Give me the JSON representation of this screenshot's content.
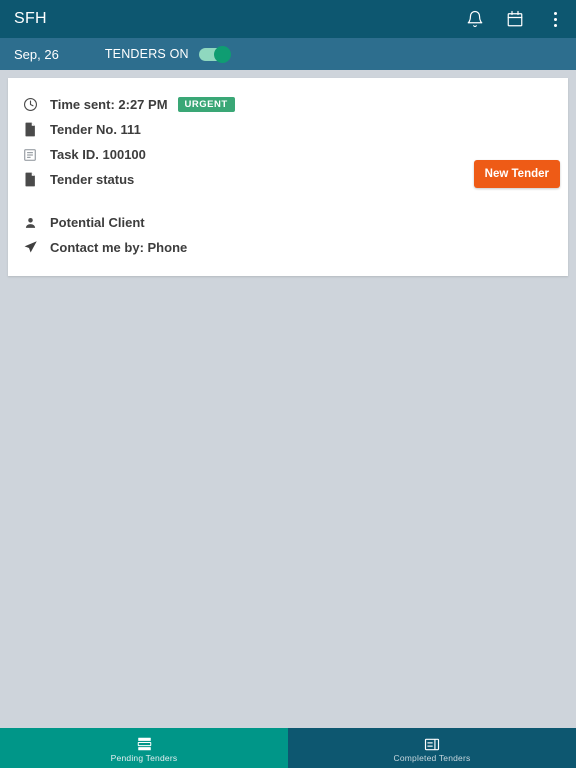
{
  "appbar": {
    "title": "SFH",
    "actions": [
      {
        "name": "notifications-icon",
        "label": "Notifications"
      },
      {
        "name": "calendar-icon",
        "label": "Calendar"
      },
      {
        "name": "overflow-menu-icon",
        "label": "More options"
      }
    ],
    "background_color": "#0d5770"
  },
  "subbar": {
    "date": "Sep, 26",
    "toggle_label": "TENDERS ON",
    "toggle_state": "on",
    "background_color": "#2d6e8e",
    "toggle_track_color": "#8fd8bf",
    "toggle_knob_color": "#0f9d72"
  },
  "card": {
    "rows": [
      {
        "icon": "clock-icon",
        "text": "Time sent: 2:27 PM",
        "badge": "URGENT"
      },
      {
        "icon": "document-icon",
        "text": "Tender No. 111",
        "badge": null
      },
      {
        "icon": "description-icon",
        "text": "Task ID. 100100",
        "badge": null
      },
      {
        "icon": "document-icon",
        "text": "Tender status",
        "badge": null
      },
      {
        "icon": "person-icon",
        "text": "Potential Client",
        "badge": null
      },
      {
        "icon": "send-icon",
        "text": "Contact me by: Phone",
        "badge": null
      }
    ],
    "badge_color": "#3aa776",
    "action_button": {
      "label": "New Tender",
      "color": "#ee5b16"
    }
  },
  "background": {
    "color": "#ced4db"
  },
  "tabbar": {
    "tabs": [
      {
        "label": "Pending Tenders",
        "icon": "table-rows-icon",
        "active": true,
        "color": "#009688"
      },
      {
        "label": "Completed Tenders",
        "icon": "dashboard-panel-icon",
        "active": false,
        "color": "#0d5770"
      }
    ]
  }
}
